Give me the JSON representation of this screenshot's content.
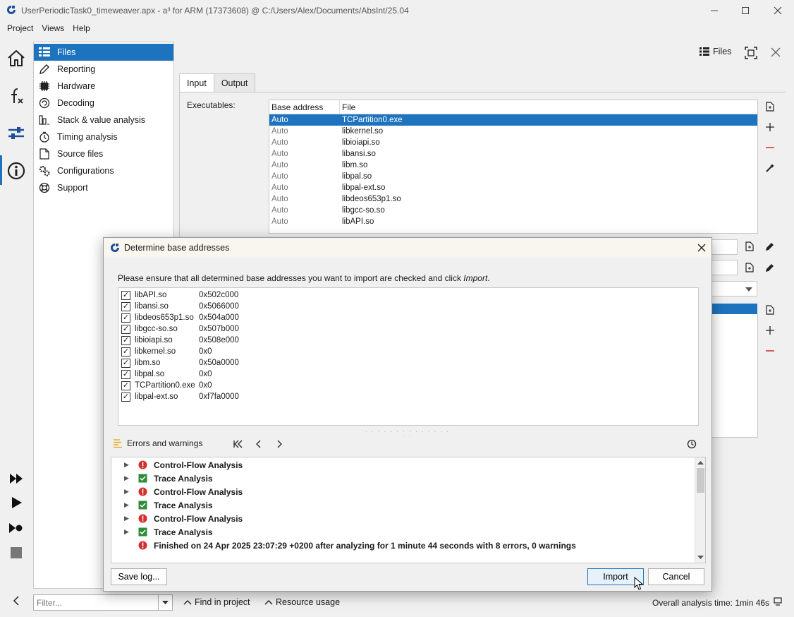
{
  "window": {
    "title": "UserPeriodicTask0_timeweaver.apx - a³ for ARM (17373608) @ C:/Users/Alex/Documents/AbsInt/25.04",
    "minimize": "—",
    "maximize": "☐",
    "close": "✕"
  },
  "menu": [
    "Project",
    "Views",
    "Help"
  ],
  "nav": {
    "items": [
      {
        "label": "Files",
        "icon": "files-icon"
      },
      {
        "label": "Reporting",
        "icon": "pencil-icon"
      },
      {
        "label": "Hardware",
        "icon": "chip-icon"
      },
      {
        "label": "Decoding",
        "icon": "decode-icon"
      },
      {
        "label": "Stack & value analysis",
        "icon": "stack-icon"
      },
      {
        "label": "Timing analysis",
        "icon": "clock-icon"
      },
      {
        "label": "Source files",
        "icon": "source-file-icon"
      },
      {
        "label": "Configurations",
        "icon": "gears-icon"
      },
      {
        "label": "Support",
        "icon": "lifebuoy-icon"
      }
    ]
  },
  "toolbar": {
    "files_label": "Files"
  },
  "tabs": [
    "Input",
    "Output"
  ],
  "executables": {
    "label": "Executables:",
    "columns": [
      "Base address",
      "File"
    ],
    "rows": [
      {
        "base": "Auto",
        "file": "TCPartition0.exe"
      },
      {
        "base": "Auto",
        "file": "libkernel.so"
      },
      {
        "base": "Auto",
        "file": "libioiapi.so"
      },
      {
        "base": "Auto",
        "file": "libansi.so"
      },
      {
        "base": "Auto",
        "file": "libm.so"
      },
      {
        "base": "Auto",
        "file": "libpal.so"
      },
      {
        "base": "Auto",
        "file": "libpal-ext.so"
      },
      {
        "base": "Auto",
        "file": "libdeos653p1.so"
      },
      {
        "base": "Auto",
        "file": "libgcc-so.so"
      },
      {
        "base": "Auto",
        "file": "libAPI.so"
      }
    ]
  },
  "dialog": {
    "title": "Determine base addresses",
    "instruction_prefix": "Please ensure that all determined base addresses you want to import are checked and click ",
    "instruction_emph": "Import",
    "instruction_suffix": ".",
    "entries": [
      {
        "name": "libAPI.so",
        "address": "0x502c000",
        "checked": true
      },
      {
        "name": "libansi.so",
        "address": "0x5066000",
        "checked": true
      },
      {
        "name": "libdeos653p1.so",
        "address": "0x504a000",
        "checked": true
      },
      {
        "name": "libgcc-so.so",
        "address": "0x507b000",
        "checked": true
      },
      {
        "name": "libioiapi.so",
        "address": "0x508e000",
        "checked": true
      },
      {
        "name": "libkernel.so",
        "address": "0x0",
        "checked": true
      },
      {
        "name": "libm.so",
        "address": "0x50a0000",
        "checked": true
      },
      {
        "name": "libpal.so",
        "address": "0x0",
        "checked": true
      },
      {
        "name": "TCPartition0.exe",
        "address": "0x0",
        "checked": true
      },
      {
        "name": "libpal-ext.so",
        "address": "0xf7fa0000",
        "checked": true
      }
    ],
    "errors_label": "Errors and warnings",
    "log": [
      {
        "text": "Control-Flow Analysis",
        "status": "error",
        "expandable": true
      },
      {
        "text": "Trace Analysis",
        "status": "ok",
        "expandable": true
      },
      {
        "text": "Control-Flow Analysis",
        "status": "error",
        "expandable": true
      },
      {
        "text": "Trace Analysis",
        "status": "ok",
        "expandable": true
      },
      {
        "text": "Control-Flow Analysis",
        "status": "error",
        "expandable": true
      },
      {
        "text": "Trace Analysis",
        "status": "ok",
        "expandable": true
      },
      {
        "text": "Finished on 24 Apr 2025 23:07:29 +0200 after analyzing for 1 minute 44 seconds with 8 errors, 0 warnings",
        "status": "error",
        "expandable": false
      }
    ],
    "save_log": "Save log...",
    "import": "Import",
    "cancel": "Cancel"
  },
  "status": {
    "filter_placeholder": "Filter...",
    "find_in_project": "Find in project",
    "resource_usage": "Resource usage",
    "overall_time": "Overall analysis time: 1min 46s"
  },
  "colors": {
    "accent": "#1e73be",
    "error": "#d32f2f",
    "ok": "#2e8b3a"
  }
}
